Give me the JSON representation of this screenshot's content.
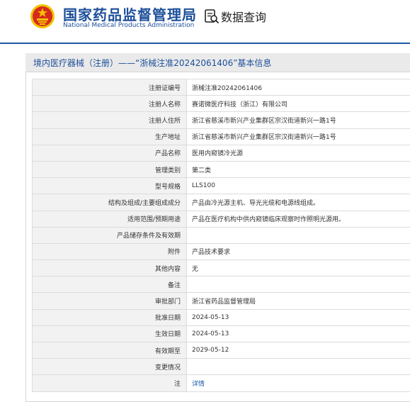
{
  "header": {
    "title_cn": "国家药品监督管理局",
    "title_en": "National Medical Products Administration",
    "search_label": "数据查询"
  },
  "panel": {
    "title": "境内医疗器械（注册）——“浙械注准20242061406”基本信息"
  },
  "rows": [
    {
      "label": "注册证编号",
      "value": "浙械注准20242061406"
    },
    {
      "label": "注册人名称",
      "value": "赛诺微医疗科技（浙江）有限公司"
    },
    {
      "label": "注册人住所",
      "value": "浙江省慈溪市新兴产业集群区宗汉街道新兴一路1号"
    },
    {
      "label": "生产地址",
      "value": "浙江省慈溪市新兴产业集群区宗汉街道新兴一路1号"
    },
    {
      "label": "产品名称",
      "value": "医用内窥镜冷光源"
    },
    {
      "label": "管理类别",
      "value": "第二类"
    },
    {
      "label": "型号规格",
      "value": "LLS100"
    },
    {
      "label": "结构及组成/主要组成成分",
      "value": "产品由冷光源主机、导光光缆和电源线组成。"
    },
    {
      "label": "适用范围/预期用途",
      "value": "产品在医疗机构中供内窥镜临床观察时作照明光源用。"
    },
    {
      "label": "产品储存条件及有效期",
      "value": ""
    },
    {
      "label": "附件",
      "value": "产品技术要求"
    },
    {
      "label": "其他内容",
      "value": "无"
    },
    {
      "label": "备注",
      "value": ""
    },
    {
      "label": "审批部门",
      "value": "浙江省药品监督管理局"
    },
    {
      "label": "批准日期",
      "value": "2024-05-13"
    },
    {
      "label": "生效日期",
      "value": "2024-05-13"
    },
    {
      "label": "有效期至",
      "value": "2029-05-12"
    },
    {
      "label": "变更情况",
      "value": ""
    },
    {
      "label": "注",
      "value": "详情"
    }
  ],
  "colors": {
    "brand_blue": "#1d4f9a",
    "emblem_red": "#d52b1e",
    "emblem_gold": "#f2c200",
    "link_blue": "#1d5aa8"
  }
}
